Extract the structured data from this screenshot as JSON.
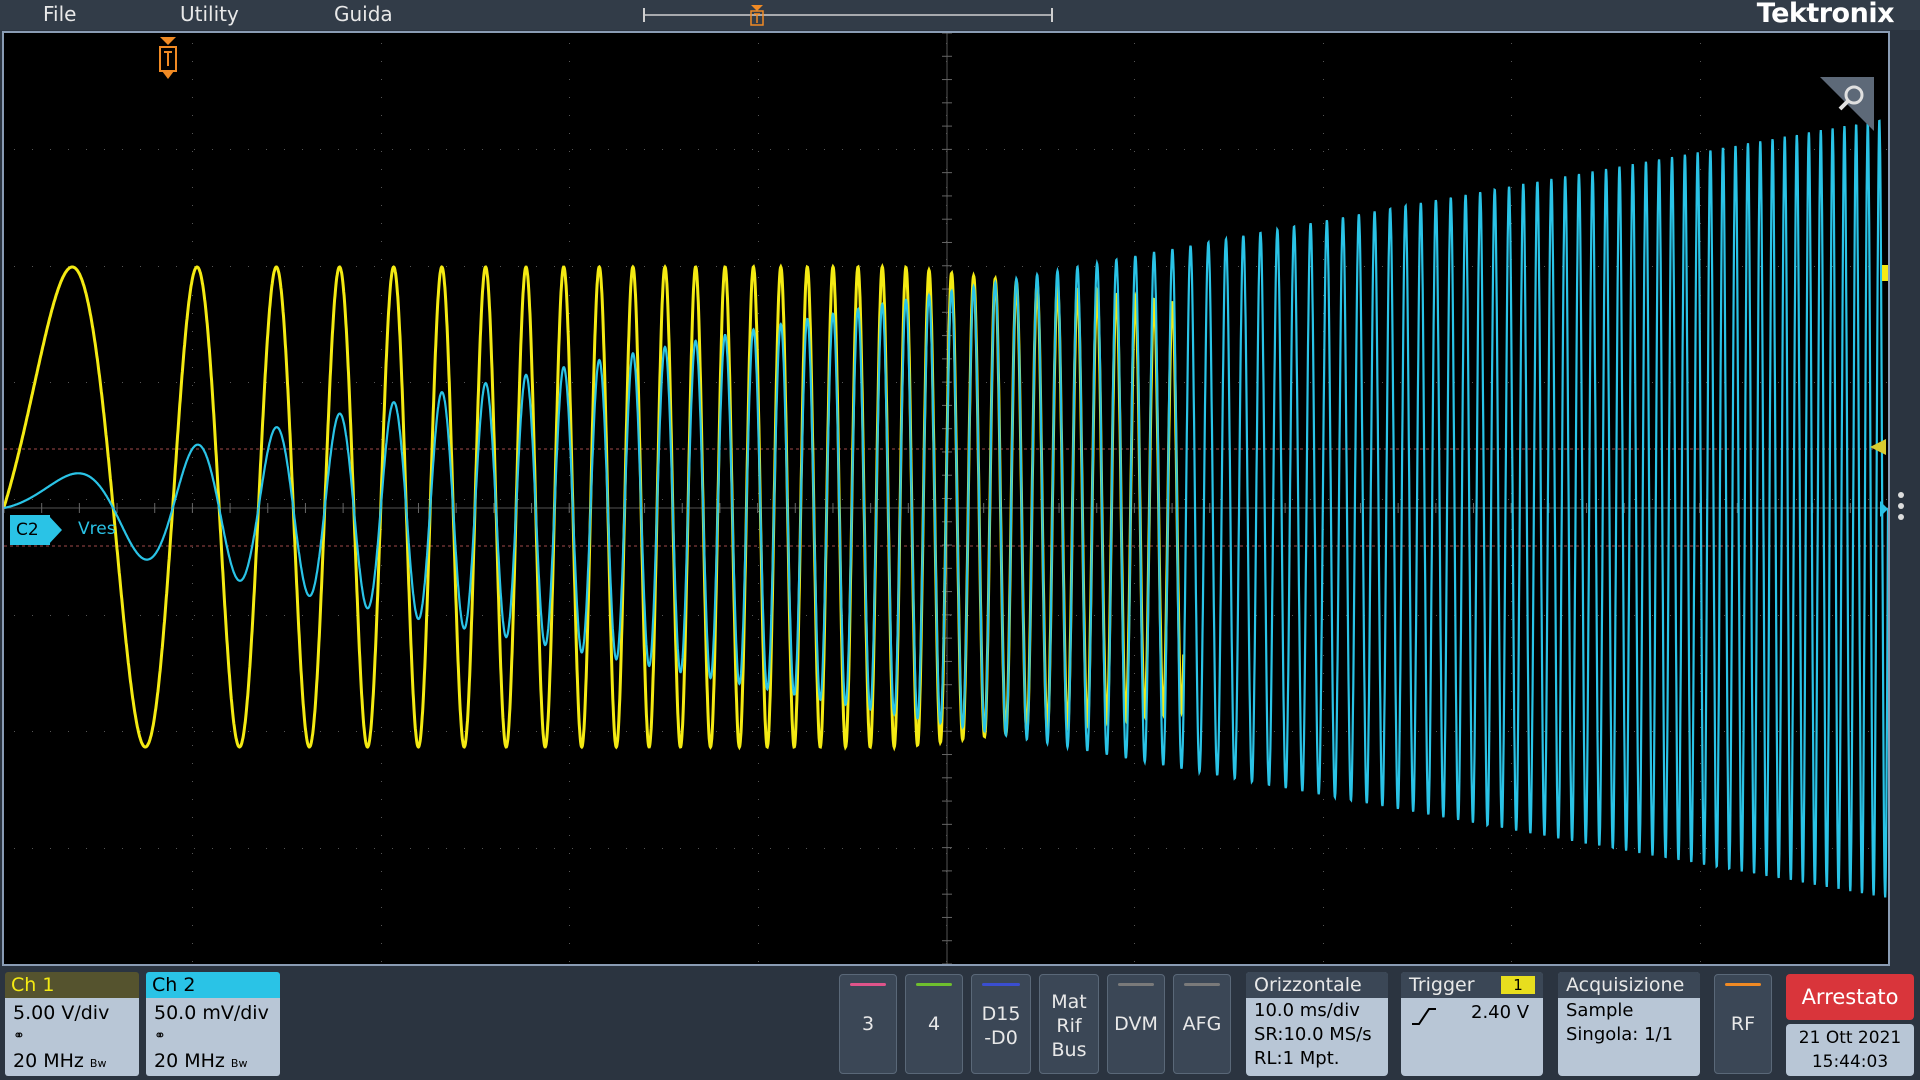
{
  "menu": {
    "file": "File",
    "utility": "Utility",
    "help": "Guida"
  },
  "brand": "Tektronix",
  "trigger_marker_letter": "T",
  "waveform": {
    "c2_label": "C2",
    "c2_name": "Vres",
    "ch1_color": "#f4ea13",
    "ch2_color": "#2ac3e6"
  },
  "ch1": {
    "title": "Ch 1",
    "scale": "5.00 V/div",
    "bw": "20 MHz",
    "bw_suffix": "Bw",
    "color": "#f4ea13"
  },
  "ch2": {
    "title": "Ch 2",
    "scale": "50.0 mV/div",
    "bw": "20 MHz",
    "bw_suffix": "Bw",
    "color": "#2ac3e6"
  },
  "buttons": {
    "ch3": "3",
    "ch4": "4",
    "digital_l1": "D15",
    "digital_l2": "-D0",
    "math_l1": "Mat",
    "math_l2": "Rif",
    "math_l3": "Bus",
    "dvm": "DVM",
    "afg": "AFG",
    "rf": "RF"
  },
  "horizontal": {
    "title": "Orizzontale",
    "scale": "10.0 ms/div",
    "sample_rate": "SR:10.0 MS/s",
    "record_length": "RL:1 Mpt."
  },
  "trigger": {
    "title": "Trigger",
    "source": "1",
    "level": "2.40 V"
  },
  "acquisition": {
    "title": "Acquisizione",
    "mode": "Sample",
    "single": "Singola: 1/1"
  },
  "status": {
    "run_state": "Arrestato",
    "date": "21 Ott 2021",
    "time": "15:44:03"
  }
}
